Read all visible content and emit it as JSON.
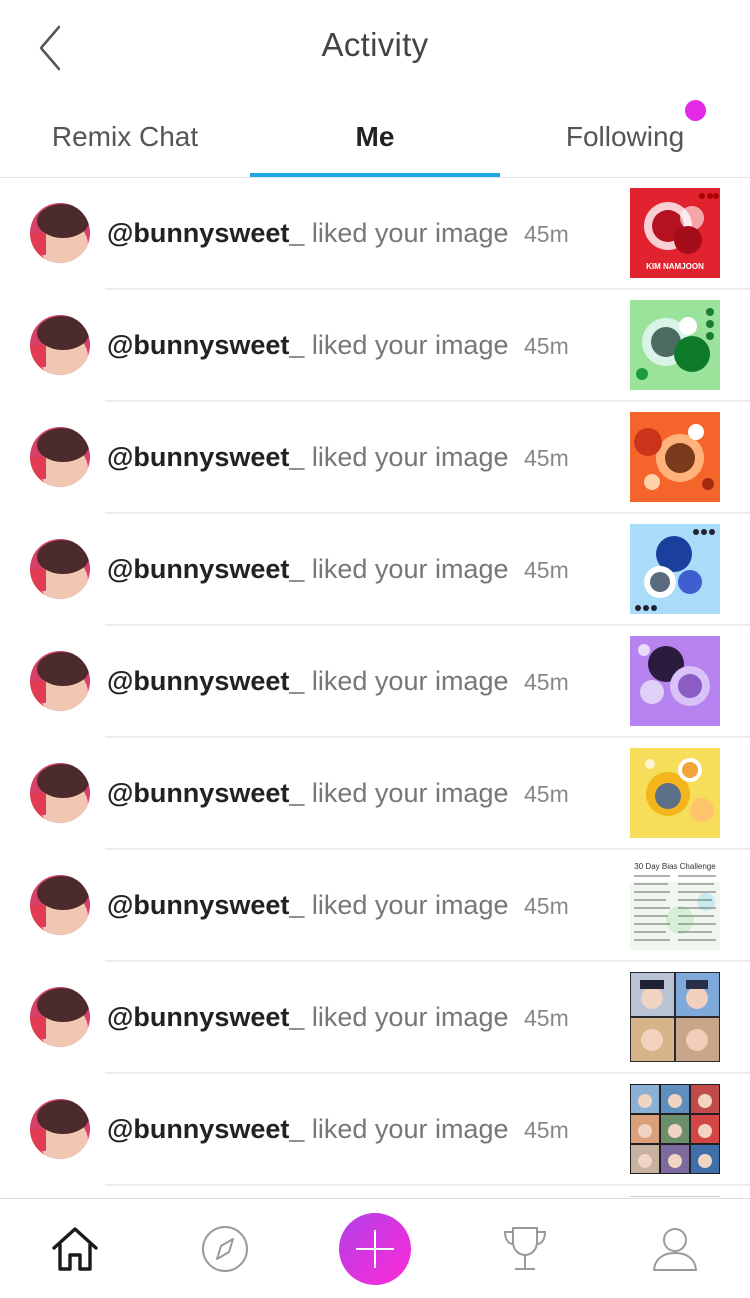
{
  "header": {
    "title": "Activity",
    "back_icon": "chevron-left-icon"
  },
  "tabs": [
    {
      "label": "Remix Chat",
      "active": false
    },
    {
      "label": "Me",
      "active": true
    },
    {
      "label": "Following",
      "active": false,
      "has_notification": true
    }
  ],
  "colors": {
    "tab_indicator": "#1ea7e4",
    "notification_dot": "#e328e6",
    "fab_start": "#b13fe8",
    "fab_end": "#ff2bd6"
  },
  "activity": [
    {
      "username": "@bunnysweet_",
      "action": "liked your image",
      "time": "45m",
      "thumb_text": "KIM NAMJOON"
    },
    {
      "username": "@bunnysweet_",
      "action": "liked your image",
      "time": "45m"
    },
    {
      "username": "@bunnysweet_",
      "action": "liked your image",
      "time": "45m"
    },
    {
      "username": "@bunnysweet_",
      "action": "liked your image",
      "time": "45m"
    },
    {
      "username": "@bunnysweet_",
      "action": "liked your image",
      "time": "45m"
    },
    {
      "username": "@bunnysweet_",
      "action": "liked your image",
      "time": "45m"
    },
    {
      "username": "@bunnysweet_",
      "action": "liked your image",
      "time": "45m",
      "thumb_text": "30 Day Bias Challenge"
    },
    {
      "username": "@bunnysweet_",
      "action": "liked your image",
      "time": "45m"
    },
    {
      "username": "@bunnysweet_",
      "action": "liked your image",
      "time": "45m"
    }
  ],
  "bottom_nav": [
    {
      "icon": "home-icon",
      "active": true
    },
    {
      "icon": "compass-icon"
    },
    {
      "icon": "plus-icon",
      "primary": true
    },
    {
      "icon": "trophy-icon"
    },
    {
      "icon": "profile-icon"
    }
  ]
}
